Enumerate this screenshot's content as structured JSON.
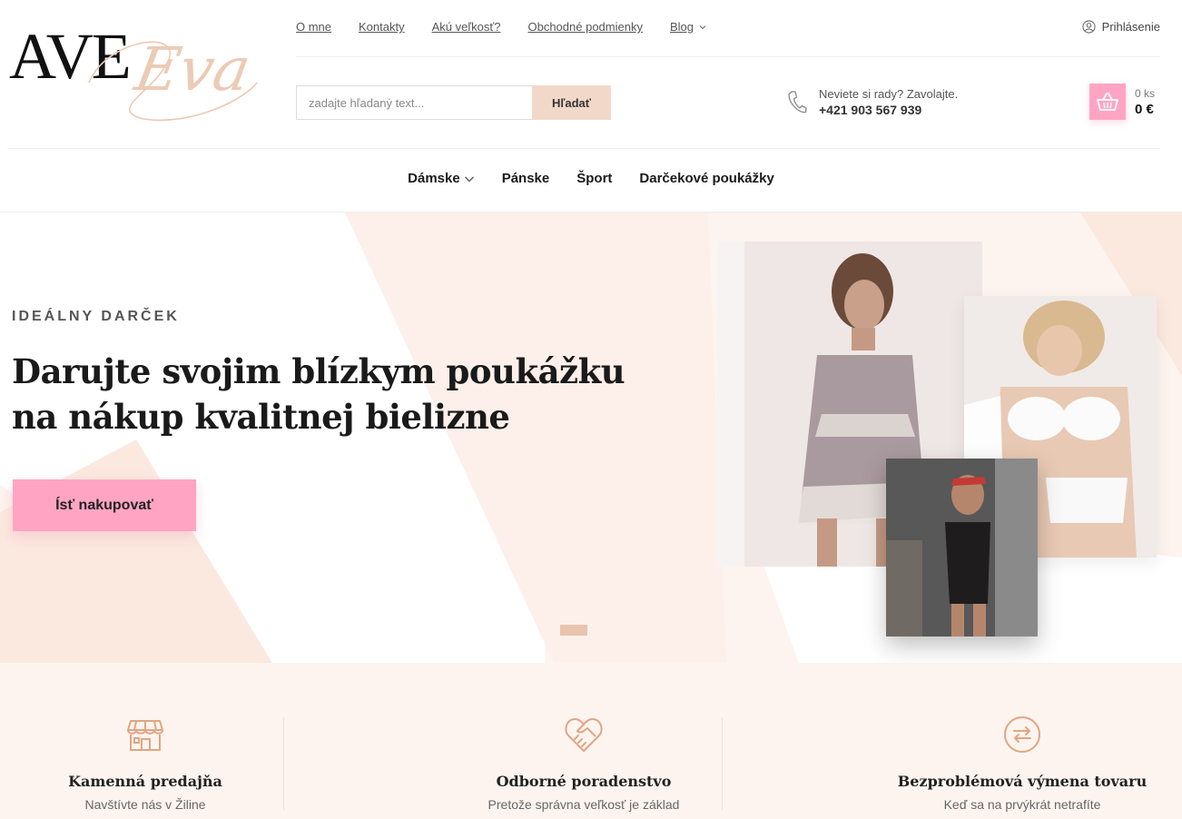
{
  "brand": {
    "name_main": "AVE",
    "name_script": "Eva"
  },
  "topnav": [
    {
      "label": "O mne"
    },
    {
      "label": "Kontakty"
    },
    {
      "label": "Akú veľkosť?"
    },
    {
      "label": "Obchodné podmienky"
    },
    {
      "label": "Blog"
    }
  ],
  "login": {
    "label": "Prihlásenie"
  },
  "search": {
    "placeholder": "zadajte hľadaný text...",
    "button": "Hľadať"
  },
  "contact": {
    "question": "Neviete si rady? Zavolajte.",
    "phone": "+421 903 567 939"
  },
  "cart": {
    "quantity": "0 ks",
    "total": "0 €"
  },
  "mainnav": [
    {
      "label": "Dámske"
    },
    {
      "label": "Pánske"
    },
    {
      "label": "Šport"
    },
    {
      "label": "Darčekové poukážky"
    }
  ],
  "hero": {
    "eyebrow": "IDEÁLNY DARČEK",
    "headline": "Darujte svojim blízkym poukážku na nákup kvalitnej bielizne",
    "cta": "Ísť nakupovať",
    "slides_total": 1,
    "slide_active": 1
  },
  "features": [
    {
      "icon": "store-icon",
      "title": "Kamenná predajňa",
      "subtitle": "Navštívte nás v Žiline"
    },
    {
      "icon": "handshake-heart-icon",
      "title": "Odborné poradenstvo",
      "subtitle": "Pretože správna veľkosť je základ"
    },
    {
      "icon": "exchange-icon",
      "title": "Bezproblémová výmena tovaru",
      "subtitle": "Keď sa na prvýkrát netrafíte"
    }
  ],
  "colors": {
    "accent_pink": "#ffa5c3",
    "accent_peach": "#f2d8c8",
    "hero_bg": "#fdf4ef",
    "icon_color": "#e1a582"
  }
}
